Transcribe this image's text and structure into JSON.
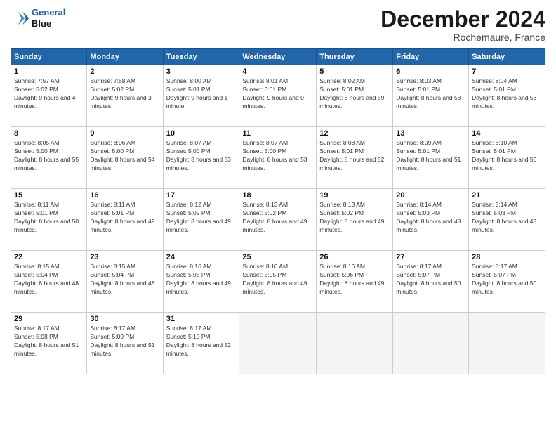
{
  "logo": {
    "line1": "General",
    "line2": "Blue"
  },
  "header": {
    "month": "December 2024",
    "location": "Rochemaure, France"
  },
  "weekdays": [
    "Sunday",
    "Monday",
    "Tuesday",
    "Wednesday",
    "Thursday",
    "Friday",
    "Saturday"
  ],
  "weeks": [
    [
      {
        "day": 1,
        "sunrise": "7:57 AM",
        "sunset": "5:02 PM",
        "daylight": "9 hours and 4 minutes."
      },
      {
        "day": 2,
        "sunrise": "7:58 AM",
        "sunset": "5:02 PM",
        "daylight": "9 hours and 3 minutes."
      },
      {
        "day": 3,
        "sunrise": "8:00 AM",
        "sunset": "5:01 PM",
        "daylight": "9 hours and 1 minute."
      },
      {
        "day": 4,
        "sunrise": "8:01 AM",
        "sunset": "5:01 PM",
        "daylight": "9 hours and 0 minutes."
      },
      {
        "day": 5,
        "sunrise": "8:02 AM",
        "sunset": "5:01 PM",
        "daylight": "8 hours and 59 minutes."
      },
      {
        "day": 6,
        "sunrise": "8:03 AM",
        "sunset": "5:01 PM",
        "daylight": "8 hours and 58 minutes."
      },
      {
        "day": 7,
        "sunrise": "8:04 AM",
        "sunset": "5:01 PM",
        "daylight": "8 hours and 56 minutes."
      }
    ],
    [
      {
        "day": 8,
        "sunrise": "8:05 AM",
        "sunset": "5:00 PM",
        "daylight": "8 hours and 55 minutes."
      },
      {
        "day": 9,
        "sunrise": "8:06 AM",
        "sunset": "5:00 PM",
        "daylight": "8 hours and 54 minutes."
      },
      {
        "day": 10,
        "sunrise": "8:07 AM",
        "sunset": "5:00 PM",
        "daylight": "8 hours and 53 minutes."
      },
      {
        "day": 11,
        "sunrise": "8:07 AM",
        "sunset": "5:00 PM",
        "daylight": "8 hours and 53 minutes."
      },
      {
        "day": 12,
        "sunrise": "8:08 AM",
        "sunset": "5:01 PM",
        "daylight": "8 hours and 52 minutes."
      },
      {
        "day": 13,
        "sunrise": "8:09 AM",
        "sunset": "5:01 PM",
        "daylight": "8 hours and 51 minutes."
      },
      {
        "day": 14,
        "sunrise": "8:10 AM",
        "sunset": "5:01 PM",
        "daylight": "8 hours and 50 minutes."
      }
    ],
    [
      {
        "day": 15,
        "sunrise": "8:11 AM",
        "sunset": "5:01 PM",
        "daylight": "8 hours and 50 minutes."
      },
      {
        "day": 16,
        "sunrise": "8:11 AM",
        "sunset": "5:01 PM",
        "daylight": "8 hours and 49 minutes."
      },
      {
        "day": 17,
        "sunrise": "8:12 AM",
        "sunset": "5:02 PM",
        "daylight": "8 hours and 49 minutes."
      },
      {
        "day": 18,
        "sunrise": "8:13 AM",
        "sunset": "5:02 PM",
        "daylight": "8 hours and 49 minutes."
      },
      {
        "day": 19,
        "sunrise": "8:13 AM",
        "sunset": "5:02 PM",
        "daylight": "8 hours and 49 minutes."
      },
      {
        "day": 20,
        "sunrise": "8:14 AM",
        "sunset": "5:03 PM",
        "daylight": "8 hours and 48 minutes."
      },
      {
        "day": 21,
        "sunrise": "8:14 AM",
        "sunset": "5:03 PM",
        "daylight": "8 hours and 48 minutes."
      }
    ],
    [
      {
        "day": 22,
        "sunrise": "8:15 AM",
        "sunset": "5:04 PM",
        "daylight": "8 hours and 48 minutes."
      },
      {
        "day": 23,
        "sunrise": "8:15 AM",
        "sunset": "5:04 PM",
        "daylight": "8 hours and 48 minutes."
      },
      {
        "day": 24,
        "sunrise": "8:16 AM",
        "sunset": "5:05 PM",
        "daylight": "8 hours and 49 minutes."
      },
      {
        "day": 25,
        "sunrise": "8:16 AM",
        "sunset": "5:05 PM",
        "daylight": "8 hours and 49 minutes."
      },
      {
        "day": 26,
        "sunrise": "8:16 AM",
        "sunset": "5:06 PM",
        "daylight": "8 hours and 49 minutes."
      },
      {
        "day": 27,
        "sunrise": "8:17 AM",
        "sunset": "5:07 PM",
        "daylight": "8 hours and 50 minutes."
      },
      {
        "day": 28,
        "sunrise": "8:17 AM",
        "sunset": "5:07 PM",
        "daylight": "8 hours and 50 minutes."
      }
    ],
    [
      {
        "day": 29,
        "sunrise": "8:17 AM",
        "sunset": "5:08 PM",
        "daylight": "8 hours and 51 minutes."
      },
      {
        "day": 30,
        "sunrise": "8:17 AM",
        "sunset": "5:09 PM",
        "daylight": "8 hours and 51 minutes."
      },
      {
        "day": 31,
        "sunrise": "8:17 AM",
        "sunset": "5:10 PM",
        "daylight": "8 hours and 52 minutes."
      },
      null,
      null,
      null,
      null
    ]
  ]
}
